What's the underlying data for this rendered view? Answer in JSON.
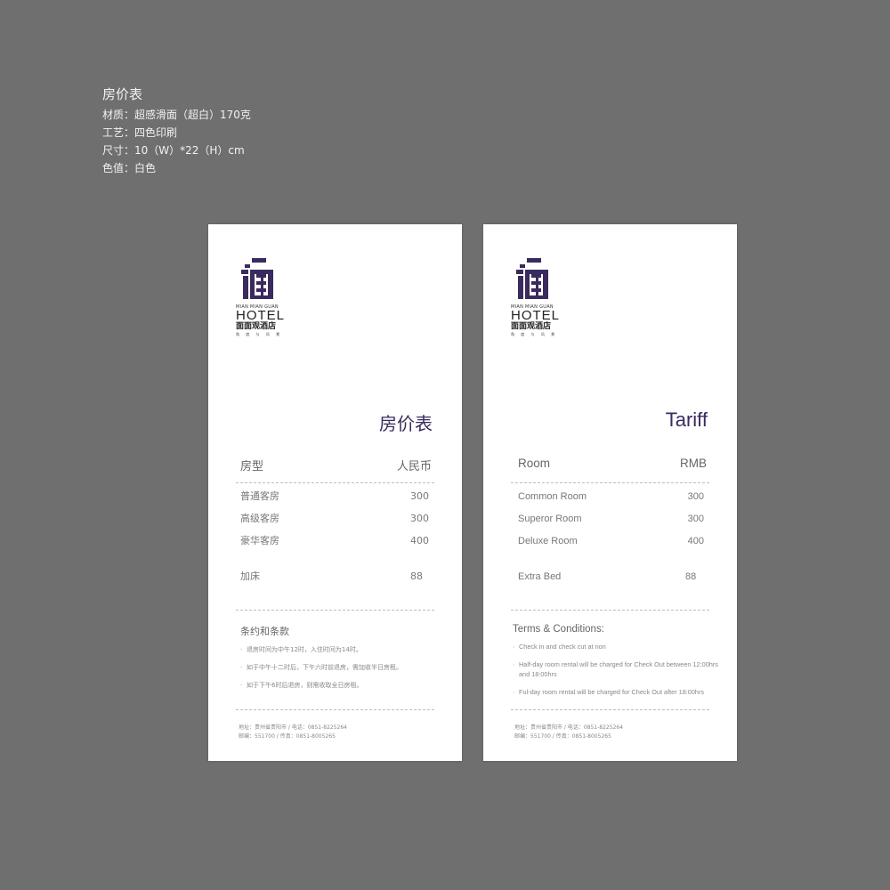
{
  "spec": {
    "title": "房价表",
    "lines": [
      "材质：超感滑面（超白）170克",
      "工艺：四色印刷",
      "尺寸：10（W）*22（H）cm",
      "色值：白色"
    ]
  },
  "brand": {
    "mark_icon": "mian-logo-icon",
    "sub": "MIAN MIAN GUAN",
    "hotel": "HOTEL",
    "name_cn": "面面观酒店",
    "tagline": "角 度 与 风 景",
    "accent_color": "#3b2a5e"
  },
  "cards": {
    "cn": {
      "heading": "房价表",
      "col_room": "房型",
      "col_price": "人民币",
      "rows": [
        {
          "room": "普通客房",
          "price": "300"
        },
        {
          "room": "高级客房",
          "price": "300"
        },
        {
          "room": "豪华客房",
          "price": "400"
        }
      ],
      "extra": {
        "room": "加床",
        "price": "88"
      },
      "terms_title": "条约和条款",
      "terms": [
        "退房时间为中午12时，入住时间为14时。",
        "如于中午十二时后，下午六时前退房，需加收半日房租。",
        "如于下午6时后退房，则需收取全日房租。"
      ],
      "footer": [
        "地址：贵州省贵阳市 / 电话：0851-8225264",
        "邮编：551700 / 传真：0851-8005265"
      ]
    },
    "en": {
      "heading": "Tariff",
      "col_room": "Room",
      "col_price": "RMB",
      "rows": [
        {
          "room": "Common Room",
          "price": "300"
        },
        {
          "room": "Superor Room",
          "price": "300"
        },
        {
          "room": "Deluxe Room",
          "price": "400"
        }
      ],
      "extra": {
        "room": "Extra Bed",
        "price": "88"
      },
      "terms_title": "Terms & Conditions:",
      "terms": [
        "Check in and check cut at non",
        "Half-day room rental will be charged for Check Out between 12:00hrs and 18:00hrs",
        "Ful-day room rental will be charged for Check Out after 18:00hrs"
      ],
      "footer": [
        "地址：贵州省贵阳市 / 电话：0851-8225264",
        "邮编：551700 / 传真：0851-8005265"
      ]
    }
  },
  "bullet": "·"
}
